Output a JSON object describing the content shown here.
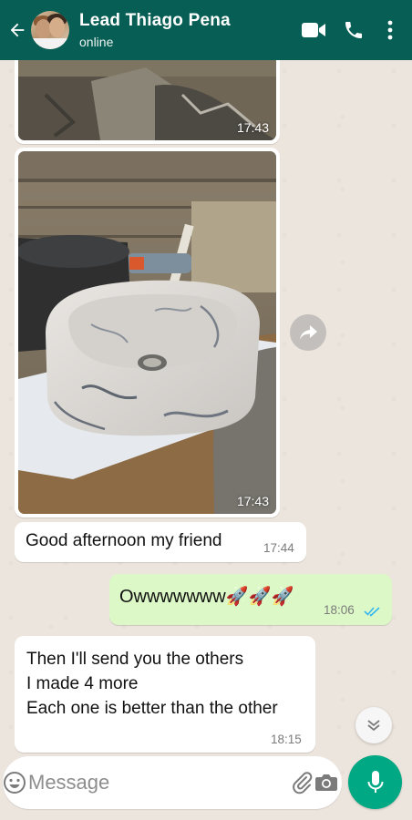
{
  "header": {
    "contact_name": "Lead Thiago Pena",
    "status": "online",
    "back_icon": "arrow-left-icon",
    "video_icon": "video-camera-icon",
    "call_icon": "phone-icon",
    "menu_icon": "more-vertical-icon"
  },
  "messages": [
    {
      "type": "image",
      "direction": "incoming",
      "time": "17:43"
    },
    {
      "type": "image",
      "direction": "incoming",
      "time": "17:43"
    },
    {
      "type": "text",
      "direction": "incoming",
      "text": "Good afternoon my friend",
      "time": "17:44"
    },
    {
      "type": "text",
      "direction": "outgoing",
      "text": "Owwwwwww🚀🚀🚀",
      "time": "18:06",
      "status": "read"
    },
    {
      "type": "text",
      "direction": "incoming",
      "lines": [
        "Then I'll send you the others",
        "I made 4 more",
        "Each one is better than the other"
      ],
      "time": "18:15"
    }
  ],
  "composer": {
    "placeholder": "Message",
    "emoji_icon": "emoji-icon",
    "attach_icon": "paperclip-icon",
    "camera_icon": "camera-icon",
    "mic_icon": "microphone-icon"
  },
  "colors": {
    "header": "#075e54",
    "outgoing_bubble": "#dcf8c6",
    "incoming_bubble": "#ffffff",
    "mic_button": "#00a884",
    "read_ticks": "#34b7f1"
  }
}
